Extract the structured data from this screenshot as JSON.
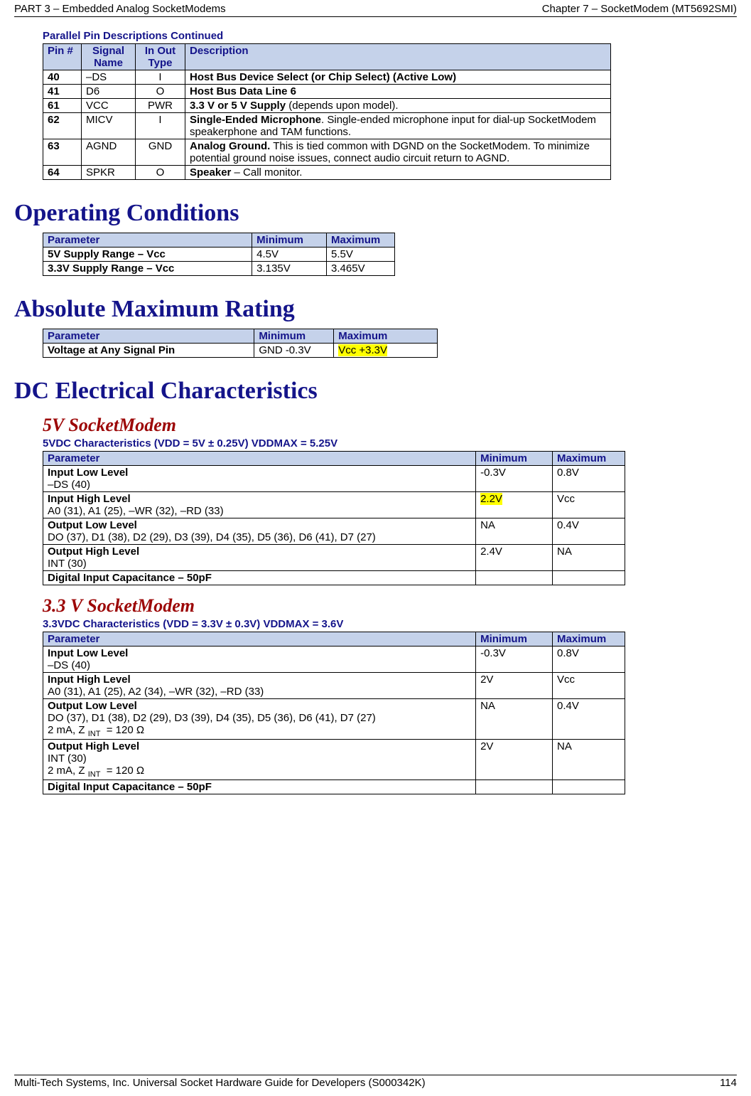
{
  "header": {
    "left": "PART 3 – Embedded Analog SocketModems",
    "right": "Chapter 7 – SocketModem (MT5692SMI)"
  },
  "footer": {
    "left": "Multi-Tech Systems, Inc. Universal Socket Hardware Guide for Developers (S000342K)",
    "right": "114"
  },
  "pin_table": {
    "caption": "Parallel Pin Descriptions Continued",
    "headers": [
      "Pin #",
      "Signal Name",
      "In Out Type",
      "Description"
    ],
    "rows": [
      {
        "pin": "40",
        "sig": "–DS",
        "io": "I",
        "desc_bold": "Host Bus Device Select (or Chip Select) (Active Low)",
        "desc_rest": ""
      },
      {
        "pin": "41",
        "sig": "D6",
        "io": "O",
        "desc_bold": "Host Bus Data Line 6",
        "desc_rest": ""
      },
      {
        "pin": "61",
        "sig": "VCC",
        "io": "PWR",
        "desc_bold": "3.3 V or 5 V Supply",
        "desc_rest": " (depends upon model)."
      },
      {
        "pin": "62",
        "sig": "MICV",
        "io": "I",
        "desc_bold": "Single-Ended Microphone",
        "desc_rest": ". Single-ended microphone input for dial-up SocketModem speakerphone and TAM functions."
      },
      {
        "pin": "63",
        "sig": "AGND",
        "io": "GND",
        "desc_bold": "Analog Ground.",
        "desc_rest": " This is tied common with DGND on the SocketModem.  To minimize potential ground noise issues, connect audio circuit return to AGND."
      },
      {
        "pin": "64",
        "sig": "SPKR",
        "io": "O",
        "desc_bold": "Speaker",
        "desc_rest": " – Call monitor."
      }
    ]
  },
  "sections": {
    "operating": "Operating Conditions",
    "absmax": "Absolute Maximum Rating",
    "dcchar": "DC Electrical Characteristics",
    "sub5v": "5V SocketModem",
    "sub33v": "3.3 V SocketModem"
  },
  "op_table": {
    "headers": [
      "Parameter",
      "Minimum",
      "Maximum"
    ],
    "rows": [
      {
        "param": "5V Supply Range – Vcc",
        "min": "4.5V",
        "max": "5.5V"
      },
      {
        "param": "3.3V Supply Range – Vcc",
        "min": "3.135V",
        "max": "3.465V"
      }
    ]
  },
  "abs_table": {
    "headers": [
      "Parameter",
      "Minimum",
      "Maximum"
    ],
    "rows": [
      {
        "param": "Voltage at Any Signal Pin",
        "min": "GND  -0.3V",
        "max": "Vcc  +3.3V",
        "max_hl": true
      }
    ]
  },
  "dc5v": {
    "caption": "5VDC Characteristics (VDD = 5V ± 0.25V) VDDMAX = 5.25V",
    "headers": [
      "Parameter",
      "Minimum",
      "Maximum"
    ],
    "rows": [
      {
        "param_l1": "Input Low Level",
        "param_l2": "–DS (40)",
        "min": "-0.3V",
        "max": "0.8V"
      },
      {
        "param_l1": "Input High Level",
        "param_l2": "A0 (31), A1 (25),  –WR (32), –RD (33)",
        "min": "2.2V",
        "min_hl": true,
        "max": "Vcc"
      },
      {
        "param_l1": "Output Low Level",
        "param_l2": "DO (37), D1 (38), D2 (29), D3 (39), D4 (35), D5 (36), D6 (41), D7 (27)",
        "min": "NA",
        "max": "0.4V"
      },
      {
        "param_l1": "Output High Level",
        "param_l2": "INT (30)",
        "min": "2.4V",
        "max": "NA"
      },
      {
        "param_l1": "Digital Input Capacitance – 50pF",
        "param_l2": "",
        "min": "",
        "max": ""
      }
    ]
  },
  "dc33v": {
    "caption": "3.3VDC Characteristics (VDD = 3.3V ± 0.3V) VDDMAX = 3.6V",
    "headers": [
      "Parameter",
      "Minimum",
      "Maximum"
    ],
    "rows": [
      {
        "param_l1": "Input Low Level",
        "param_l2": "–DS (40)",
        "param_l3": "",
        "min": "-0.3V",
        "max": "0.8V"
      },
      {
        "param_l1": "Input High Level",
        "param_l2": "A0 (31), A1 (25), A2 (34),  –WR (32), –RD (33)",
        "param_l3": "",
        "min": "2V",
        "max": "Vcc"
      },
      {
        "param_l1": "Output Low Level",
        "param_l2": "DO (37), D1 (38), D2 (29), D3 (39), D4 (35), D5 (36), D6 (41), D7 (27)",
        "param_l3": "2 mA, Z INT  = 120 Ω",
        "min": "NA",
        "max": "0.4V"
      },
      {
        "param_l1": "Output High Level",
        "param_l2": "INT (30)",
        "param_l3": "2 mA, Z INT  = 120 Ω",
        "min": "2V",
        "max": "NA"
      },
      {
        "param_l1": "Digital Input Capacitance – 50pF",
        "param_l2": "",
        "param_l3": "",
        "min": "",
        "max": ""
      }
    ]
  }
}
